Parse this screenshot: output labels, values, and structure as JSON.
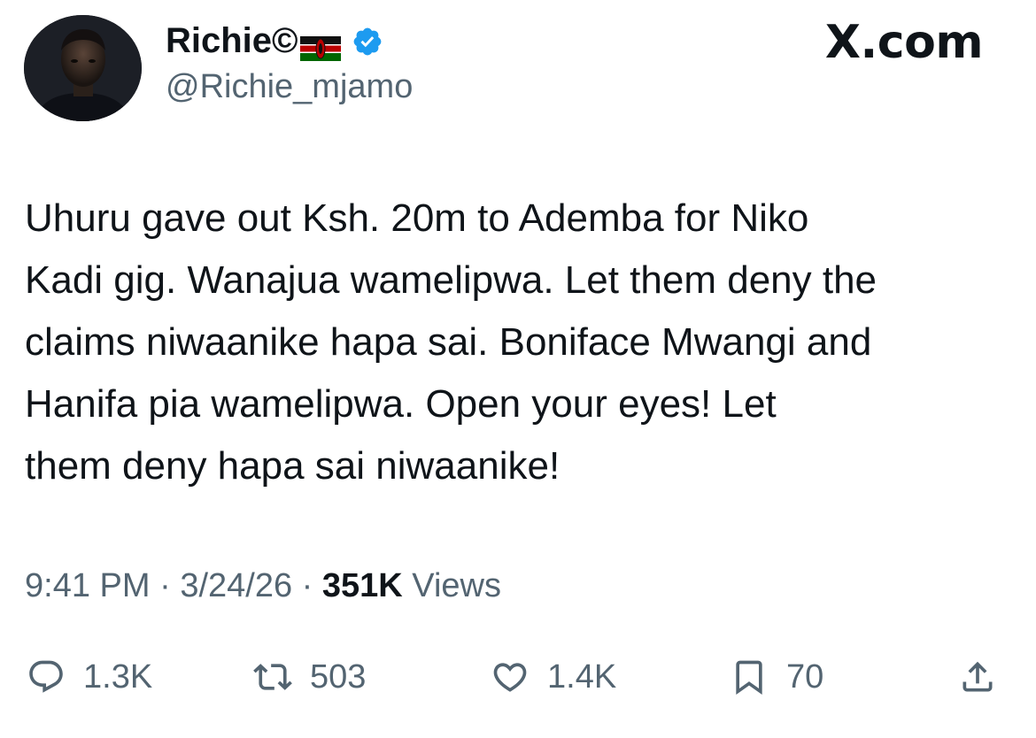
{
  "author": {
    "display_name": "Richie©",
    "handle": "@Richie_mjamo",
    "verified": true,
    "flag": "kenya-flag-icon"
  },
  "brand": {
    "logo_text": "X.com"
  },
  "tweet": {
    "text": "Uhuru gave out Ksh. 20m to Ademba for Niko\nKadi gig. Wanajua wamelipwa. Let them deny the\nclaims niwaanike hapa sai. Boniface Mwangi and\nHanifa pia wamelipwa. Open your eyes!  Let\nthem deny hapa sai niwaanike!",
    "time": "9:41 PM",
    "date": "3/24/26",
    "separator": " · ",
    "views_count": "351K",
    "views_label": " Views"
  },
  "actions": {
    "reply_count": "1.3K",
    "retweet_count": "503",
    "like_count": "1.4K",
    "bookmark_count": "70"
  },
  "colors": {
    "text": "#0f1419",
    "secondary": "#536471",
    "verified": "#1d9bf0",
    "background": "#ffffff"
  }
}
